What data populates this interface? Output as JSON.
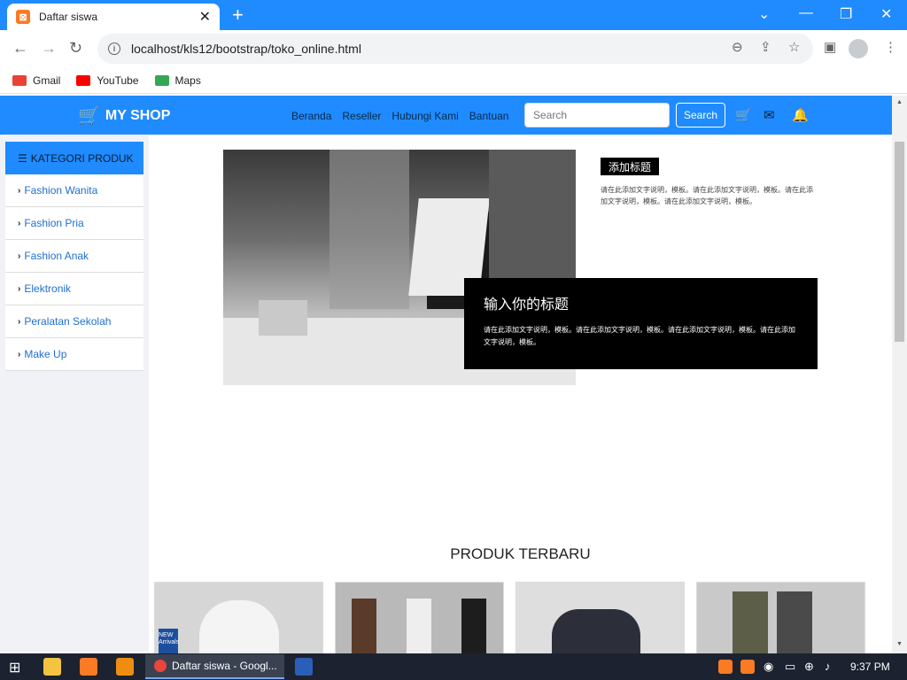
{
  "browser": {
    "tab_title": "Daftar siswa",
    "url": "localhost/kls12/bootstrap/toko_online.html",
    "bookmarks": [
      {
        "label": "Gmail",
        "icon": "gmail-icon",
        "color": "#ea4335"
      },
      {
        "label": "YouTube",
        "icon": "youtube-icon",
        "color": "#ff0000"
      },
      {
        "label": "Maps",
        "icon": "maps-icon",
        "color": "#34a853"
      }
    ]
  },
  "site": {
    "brand": "MY SHOP",
    "nav_links": [
      "Beranda",
      "Reseller",
      "Hubungi Kami",
      "Bantuan"
    ],
    "search_placeholder": "Search",
    "search_button": "Search",
    "accent": "#1f8bff"
  },
  "sidebar": {
    "title": "KATEGORI PRODUK",
    "items": [
      "Fashion Wanita",
      "Fashion Pria",
      "Fashion Anak",
      "Elektronik",
      "Peralatan Sekolah",
      "Make Up"
    ]
  },
  "hero": {
    "small_title": "添加标题",
    "small_desc": "请在此添加文字说明，模板。请在此添加文字说明，模板。请在此添加文字说明，模板。请在此添加文字说明，模板。",
    "caption_title": "输入你的标题",
    "caption_desc": "请在此添加文字说明，模板。请在此添加文字说明，模板。请在此添加文字说明，模板。请在此添加文字说明，模板。"
  },
  "products": {
    "title": "PRODUK TERBARU",
    "thumbs": [
      {
        "label": "NEW Arrivals",
        "bg": "#d6d6d6"
      },
      {
        "label": "",
        "bg": "#b9b9b9"
      },
      {
        "label": "",
        "bg": "#dedede"
      },
      {
        "label": "",
        "bg": "#c9c9c9"
      }
    ]
  },
  "taskbar": {
    "active_window": "Daftar siswa - Googl...",
    "time": "9:37 PM"
  }
}
